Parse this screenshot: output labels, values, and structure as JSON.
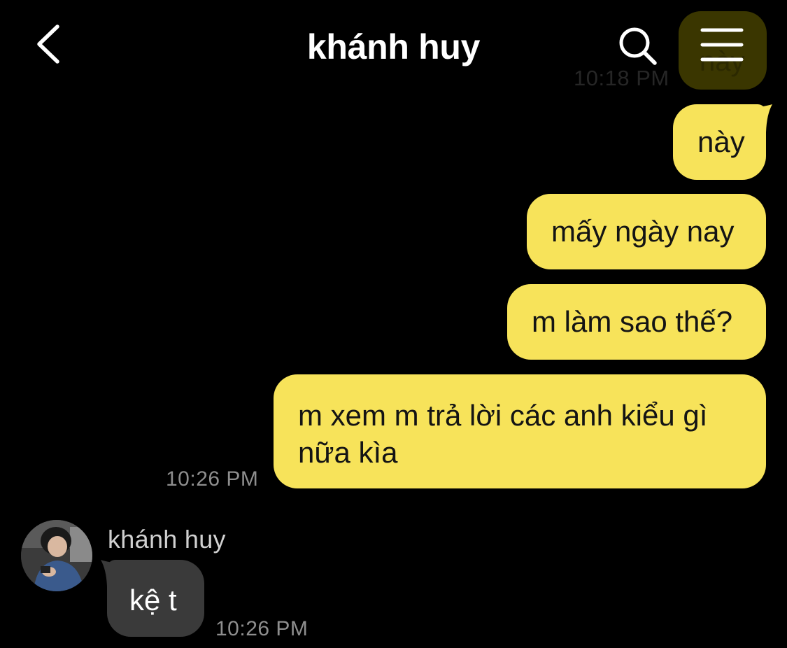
{
  "header": {
    "title": "khánh huy",
    "icons": [
      "back-icon",
      "search-icon",
      "menu-icon"
    ]
  },
  "previous_message": {
    "text": "này",
    "time": "10:18 PM"
  },
  "outgoing_messages": [
    {
      "text": "này"
    },
    {
      "text": "mấy ngày nay"
    },
    {
      "text": "m làm sao thế?"
    },
    {
      "text": "m xem m trả lời các anh kiểu gì nữa kìa"
    }
  ],
  "outgoing_time": "10:26 PM",
  "incoming": {
    "sender": "khánh huy",
    "text": "kệ t",
    "time": "10:26 PM"
  },
  "colors": {
    "background": "#000000",
    "outgoing_bubble": "#f7e35a",
    "incoming_bubble": "#3a3a3a",
    "timestamp": "#8e8e8e"
  }
}
